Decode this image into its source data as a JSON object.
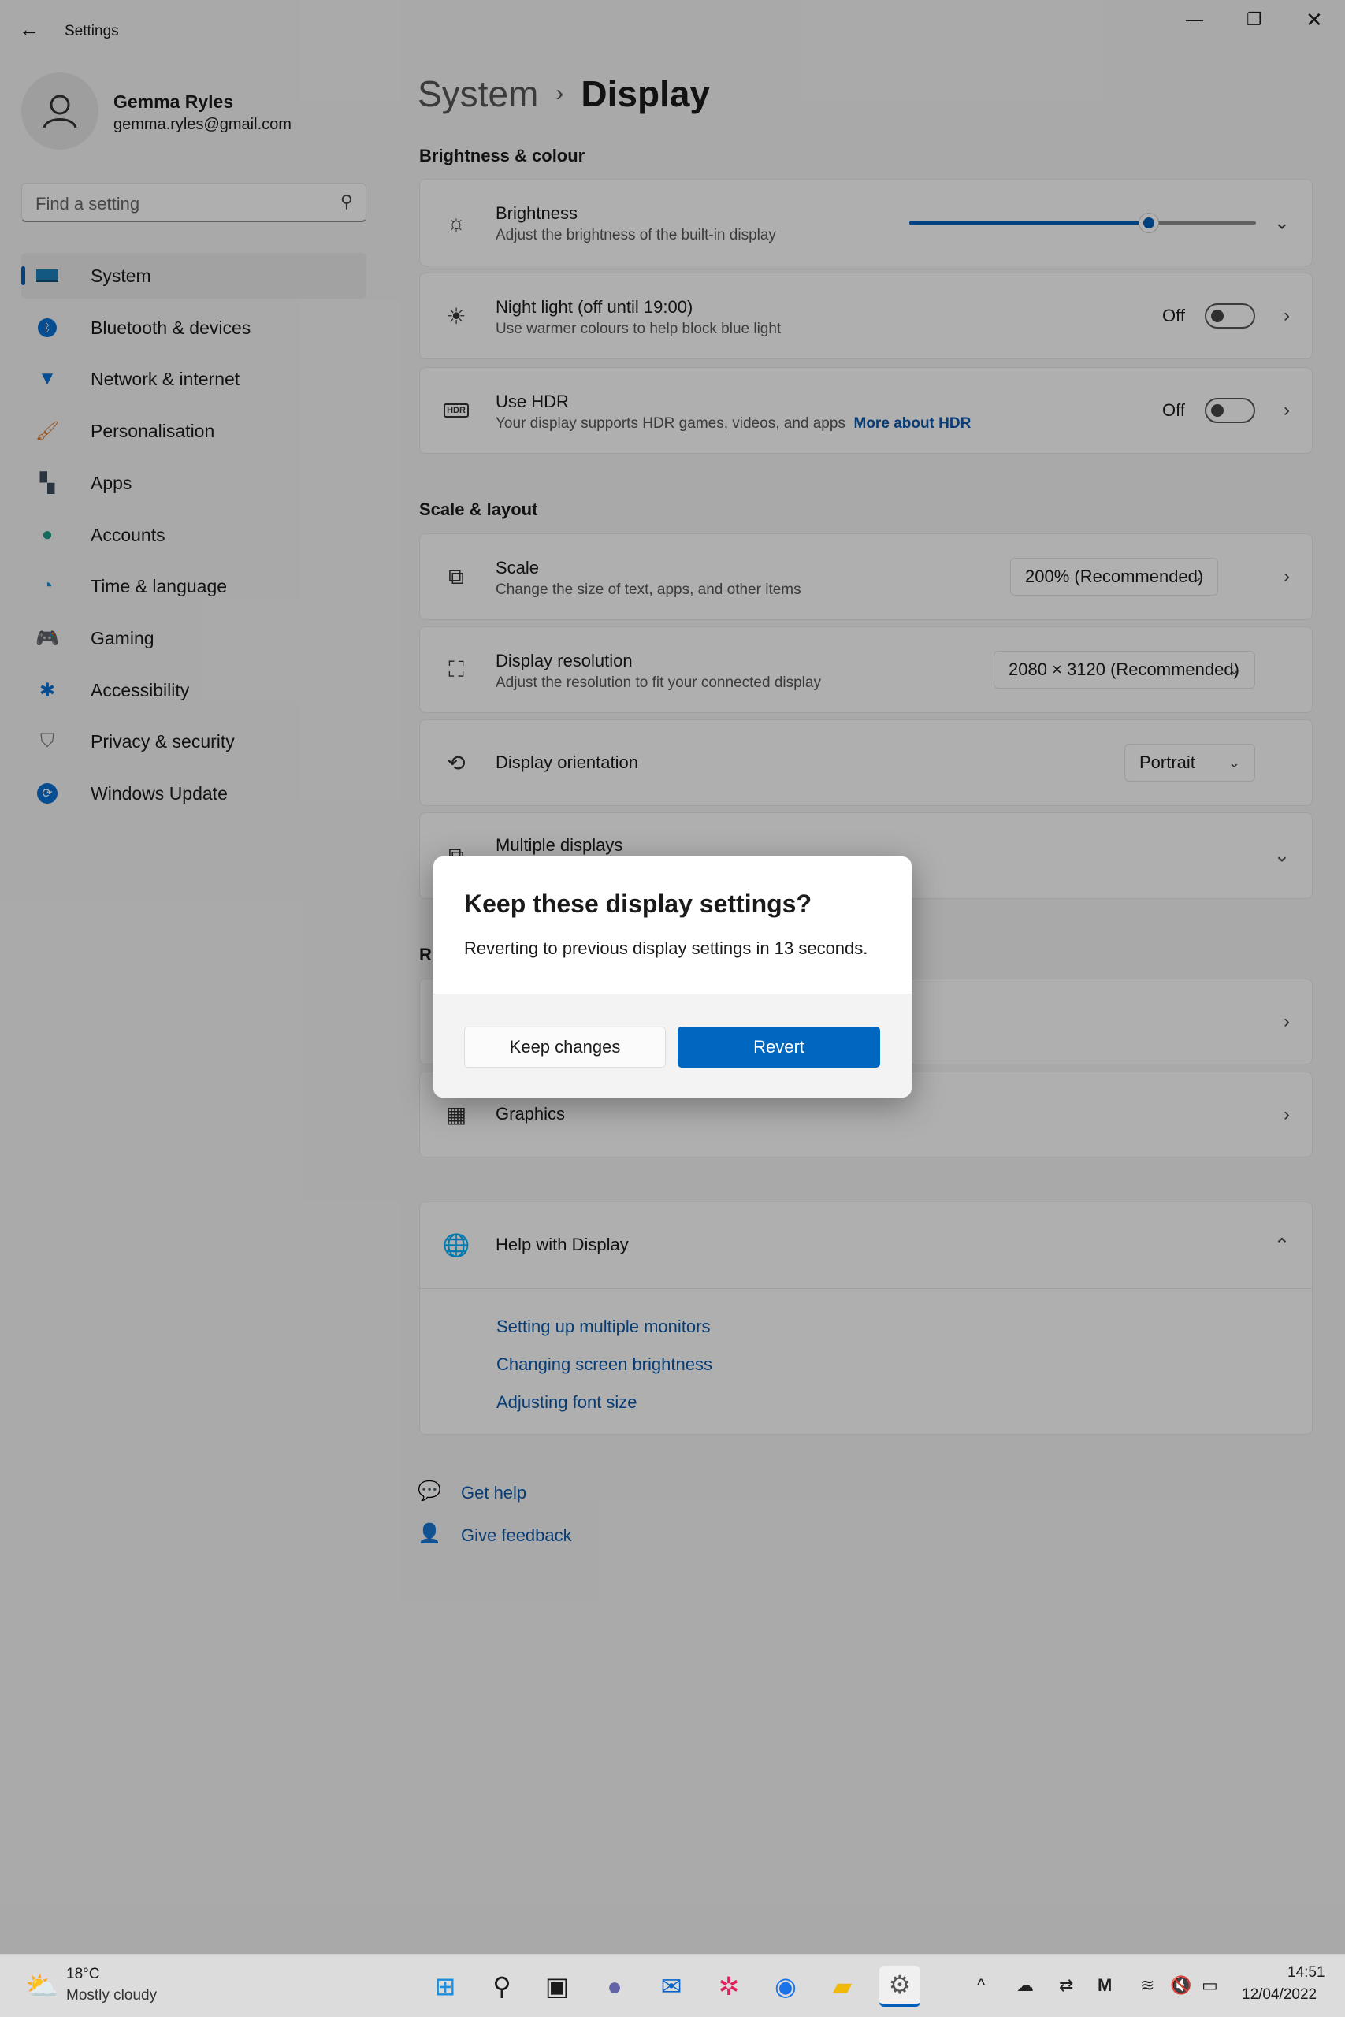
{
  "window": {
    "title": "Settings"
  },
  "profile": {
    "name": "Gemma Ryles",
    "email": "gemma.ryles@gmail.com"
  },
  "search": {
    "placeholder": "Find a setting"
  },
  "sidebar": {
    "items": [
      {
        "label": "System",
        "icon": "system-icon",
        "selected": true
      },
      {
        "label": "Bluetooth & devices",
        "icon": "bluetooth-icon"
      },
      {
        "label": "Network & internet",
        "icon": "wifi-icon"
      },
      {
        "label": "Personalisation",
        "icon": "brush-icon"
      },
      {
        "label": "Apps",
        "icon": "apps-icon"
      },
      {
        "label": "Accounts",
        "icon": "accounts-icon"
      },
      {
        "label": "Time & language",
        "icon": "clock-globe-icon"
      },
      {
        "label": "Gaming",
        "icon": "gamepad-icon"
      },
      {
        "label": "Accessibility",
        "icon": "accessibility-icon"
      },
      {
        "label": "Privacy & security",
        "icon": "shield-icon"
      },
      {
        "label": "Windows Update",
        "icon": "update-icon"
      }
    ]
  },
  "breadcrumb": {
    "parent": "System",
    "separator": "›",
    "current": "Display"
  },
  "brightness_section": {
    "title": "Brightness & colour",
    "brightness": {
      "title": "Brightness",
      "subtitle": "Adjust the brightness of the built-in display",
      "value_percent": 69
    },
    "night_light": {
      "title": "Night light (off until 19:00)",
      "subtitle": "Use warmer colours to help block blue light",
      "state": "Off"
    },
    "hdr": {
      "title": "Use HDR",
      "subtitle": "Your display supports HDR games, videos, and apps",
      "link": "More about HDR",
      "state": "Off"
    }
  },
  "scale_section": {
    "title": "Scale & layout",
    "scale": {
      "title": "Scale",
      "subtitle": "Change the size of text, apps, and other items",
      "value": "200% (Recommended)"
    },
    "resolution": {
      "title": "Display resolution",
      "subtitle": "Adjust the resolution to fit your connected display",
      "value": "2080 × 3120 (Recommended)"
    },
    "orientation": {
      "title": "Display orientation",
      "value": "Portrait"
    },
    "multiple": {
      "title": "Multiple displays"
    }
  },
  "related_section": {
    "title_visible": "R",
    "graphics": {
      "title": "Graphics"
    }
  },
  "help": {
    "title": "Help with Display",
    "links": [
      "Setting up multiple monitors",
      "Changing screen brightness",
      "Adjusting font size"
    ]
  },
  "footer_links": {
    "get_help": "Get help",
    "give_feedback": "Give feedback"
  },
  "dialog": {
    "title": "Keep these display settings?",
    "message": "Reverting to previous display settings in 13 seconds.",
    "keep": "Keep changes",
    "revert": "Revert"
  },
  "taskbar": {
    "weather_temp": "18°C",
    "weather_desc": "Mostly cloudy",
    "time": "14:51",
    "date": "12/04/2022"
  },
  "colors": {
    "accent": "#005fb8",
    "link": "#0b56a6"
  }
}
